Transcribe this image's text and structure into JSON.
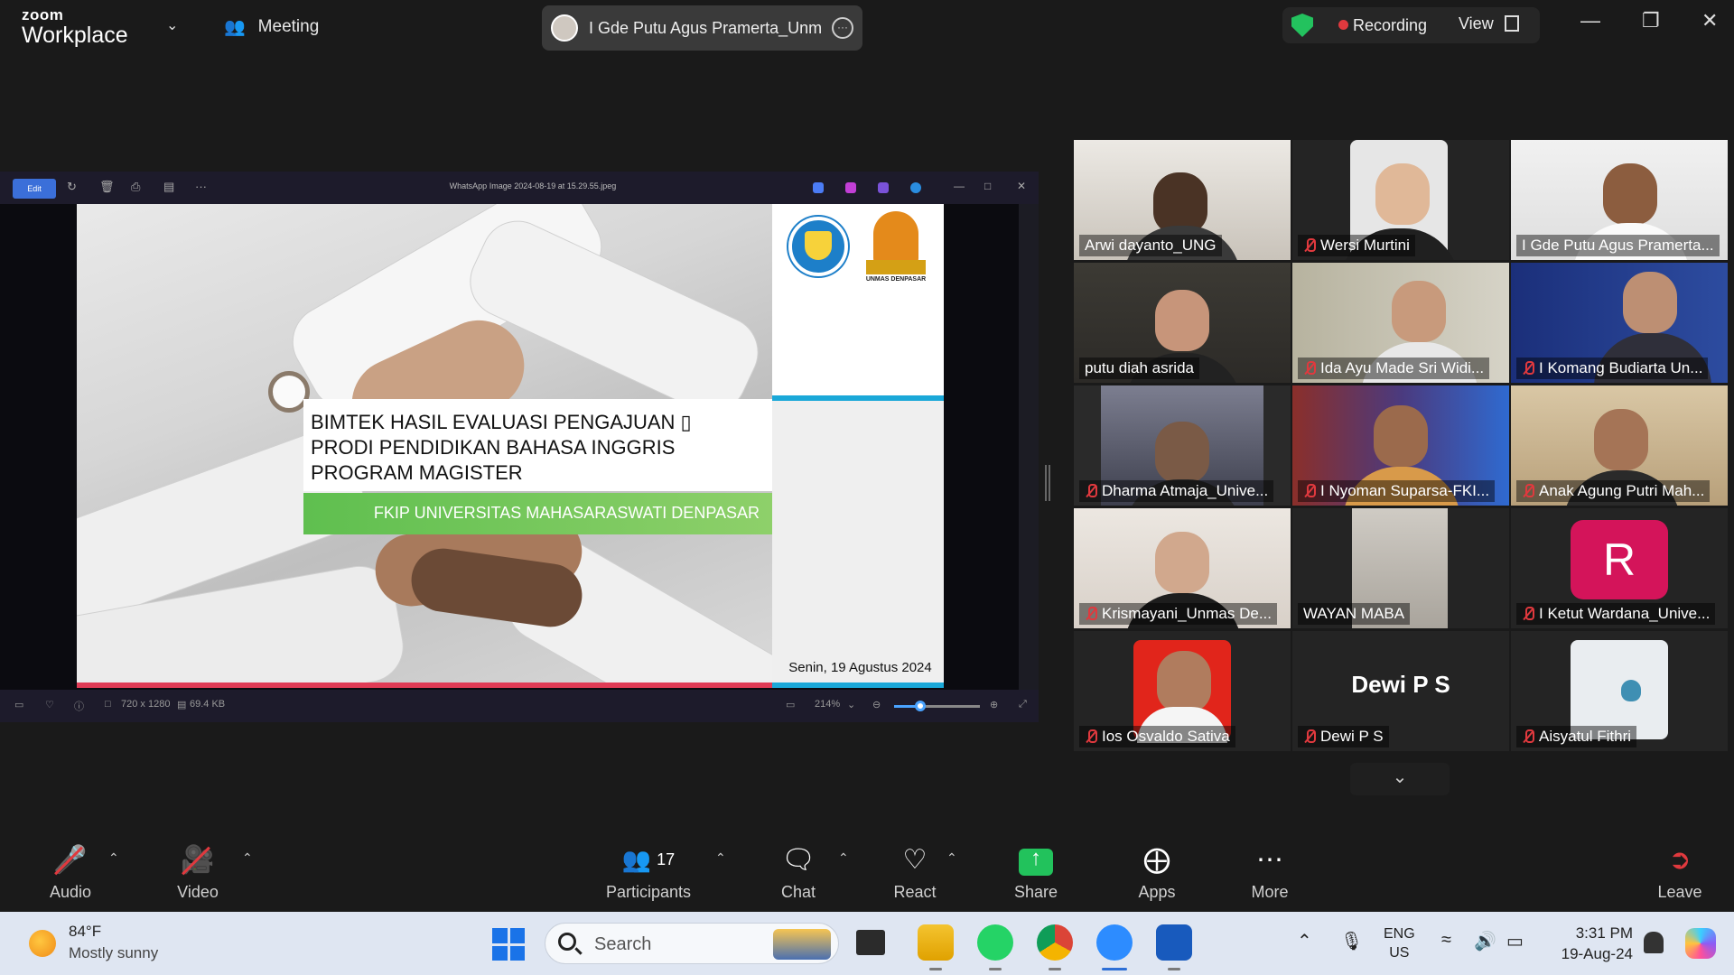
{
  "app": {
    "brand_top": "zoom",
    "brand_bottom": "Workplace",
    "meeting_label": "Meeting",
    "active_speaker": "I Gde Putu Agus Pramerta_Unma",
    "recording_label": "Recording",
    "view_label": "View"
  },
  "viewer": {
    "edit_label": "Edit",
    "file_title": "WhatsApp Image 2024-08-19 at 15.29.55.jpeg",
    "dims": "720 x 1280",
    "size": "69.4 KB",
    "zoom": "214%",
    "zoom_level_fraction": 0.3
  },
  "slide": {
    "title_lines": [
      "BIMTEK HASIL EVALUASI PENGAJUAN ▯",
      "PRODI PENDIDIKAN BAHASA INGGRIS",
      "PROGRAM MAGISTER"
    ],
    "subtitle": "FKIP UNIVERSITAS MAHASARASWATI DENPASAR",
    "logo_caption": "UNMAS DENPASAR",
    "date": "Senin, 19 Agustus 2024"
  },
  "participants": [
    {
      "name": "Arwi dayanto_UNG",
      "muted": false
    },
    {
      "name": "Wersi Murtini",
      "muted": true
    },
    {
      "name": "I Gde Putu Agus Pramerta...",
      "muted": false
    },
    {
      "name": "putu diah asrida",
      "muted": false,
      "active": true
    },
    {
      "name": "Ida Ayu Made Sri Widi...",
      "muted": true
    },
    {
      "name": "I Komang Budiarta Un...",
      "muted": true
    },
    {
      "name": "Dharma Atmaja_Unive...",
      "muted": true
    },
    {
      "name": "I Nyoman Suparsa-FKI...",
      "muted": true
    },
    {
      "name": "Anak Agung Putri Mah...",
      "muted": true
    },
    {
      "name": "Krismayani_Unmas De...",
      "muted": true
    },
    {
      "name": "WAYAN MABA",
      "muted": false
    },
    {
      "name": "I Ketut Wardana_Unive...",
      "muted": true,
      "avatar_letter": "R"
    },
    {
      "name": "Ios Osvaldo Sativa",
      "muted": true
    },
    {
      "name": "Dewi P S",
      "muted": true,
      "display_name": "Dewi P S"
    },
    {
      "name": "Aisyatul Fithri",
      "muted": true
    }
  ],
  "toolbar": {
    "audio": "Audio",
    "video": "Video",
    "participants": "Participants",
    "participant_count": "17",
    "chat": "Chat",
    "react": "React",
    "share": "Share",
    "apps": "Apps",
    "more": "More",
    "leave": "Leave"
  },
  "taskbar": {
    "temp": "84°F",
    "condition": "Mostly sunny",
    "search_placeholder": "Search",
    "lang_top": "ENG",
    "lang_bottom": "US",
    "time": "3:31 PM",
    "date": "19-Aug-24"
  }
}
